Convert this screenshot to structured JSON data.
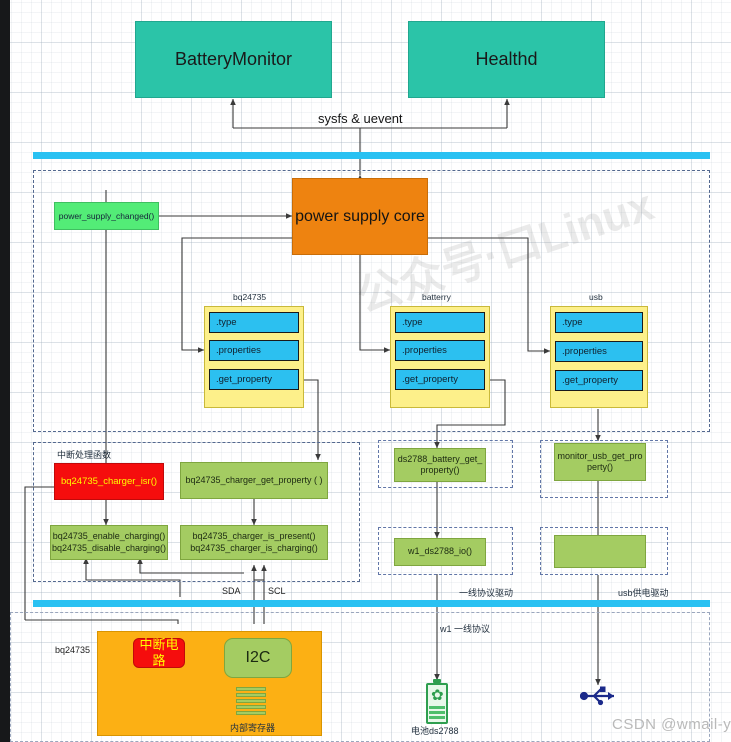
{
  "diagram": {
    "watermark_main": "CSDN @wmail-yh",
    "watermark_bg": "公众号·口Linux"
  },
  "userspace": {
    "battery_monitor": "BatteryMonitor",
    "healthd": "Healthd",
    "bus_label": "sysfs & uevent"
  },
  "kernel": {
    "power_supply_changed": "power_supply_changed()",
    "core": "power supply core",
    "cards": [
      {
        "title": "bq24735",
        "rows": [
          ".type",
          ".properties",
          ".get_property"
        ]
      },
      {
        "title": "batterry",
        "rows": [
          ".type",
          ".properties",
          ".get_property"
        ]
      },
      {
        "title": "usb",
        "rows": [
          ".type",
          ".properties",
          ".get_property"
        ]
      }
    ],
    "interrupt_group_label": "中断处理函数",
    "isr": "bq24735_charger_isr()",
    "get_property_fn": "bq24735_charger_get_property ( )",
    "enable_disable": "bq24735_enable_charging()\nbq24735_disable_charging()",
    "enable_disable_l1": "bq24735_enable_charging()",
    "enable_disable_l2": "bq24735_disable_charging()",
    "present_charging_l1": "bq24735_charger_is_present()",
    "present_charging_l2": "bq24735_charger_is_charging()",
    "ds2788_get_property_l1": "ds2788_battery_get_",
    "ds2788_get_property_l2": "property()",
    "monitor_usb_l1": "monitor_usb_get_pro",
    "monitor_usb_l2": "perty()",
    "w1_ds2788_io": "w1_ds2788_io()",
    "usb_driver_box": "",
    "onewire_driver_label": "一线协议驱动",
    "usb_power_driver_label": "usb供电驱动",
    "sda": "SDA",
    "scl": "SCL"
  },
  "hardware": {
    "chip_label": "bq24735",
    "interrupt_circuit": "中断电路",
    "i2c": "I2C",
    "internal_registers": "内部寄存器",
    "w1_protocol_label": "w1 一线协议",
    "battery_label": "电池ds2788"
  },
  "colors": {
    "teal": "#2bc4a8",
    "orange_core": "#ee8310",
    "green_fn": "#53ec77",
    "yellow_card": "#fdf08a",
    "cyan_row": "#2cc0f0",
    "olive": "#a4cc62",
    "red": "#f50d0d",
    "orange_hw": "#fcb014",
    "blue_bar": "#29c1f2",
    "dashed": "#6277a8"
  }
}
